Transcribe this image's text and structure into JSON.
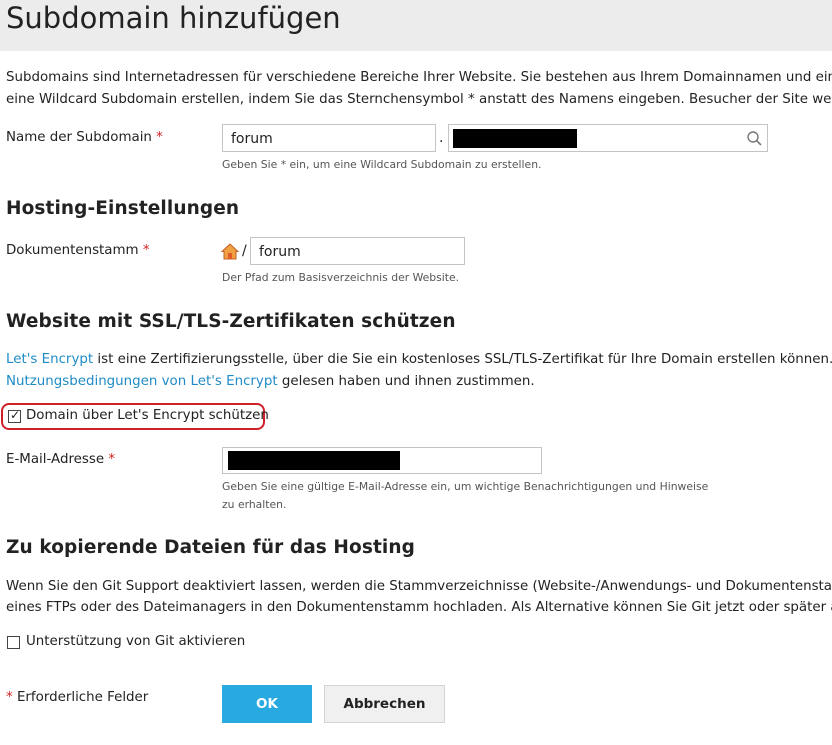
{
  "page": {
    "title": "Subdomain hinzufügen"
  },
  "intro": {
    "line1": "Subdomains sind Internetadressen für verschiedene Bereiche Ihrer Website. Sie bestehen aus Ihrem Domainnamen und einem",
    "line2": "eine Wildcard Subdomain erstellen, indem Sie das Sternchensymbol * anstatt des Namens eingeben. Besucher der Site werden"
  },
  "subdomain": {
    "label": "Name der Subdomain",
    "required_mark": "*",
    "value": "forum",
    "dot": ".",
    "hint": "Geben Sie * ein, um eine Wildcard Subdomain zu erstellen."
  },
  "hosting": {
    "heading": "Hosting-Einstellungen",
    "docroot_label": "Dokumentenstamm",
    "required_mark": "*",
    "slash": "/",
    "docroot_value": "forum",
    "hint": "Der Pfad zum Basisverzeichnis der Website."
  },
  "ssl": {
    "heading": "Website mit SSL/TLS-Zertifikaten schützen",
    "link1": "Let's Encrypt",
    "text1": " ist eine Zertifizierungsstelle, über die Sie ein kostenloses SSL/TLS-Zertifikat für Ihre Domain erstellen können. Das",
    "link2": "Nutzungsbedingungen von Let's Encrypt",
    "text2": " gelesen haben und ihnen zustimmen.",
    "checkbox_label": "Domain über Let's Encrypt schützen",
    "checkbox_checked": true,
    "email_label": "E-Mail-Adresse",
    "required_mark": "*",
    "email_hint_line1": "Geben Sie eine gültige E-Mail-Adresse ein, um wichtige Benachrichtigungen und Hinweise",
    "email_hint_line2": "zu erhalten."
  },
  "files": {
    "heading": "Zu kopierende Dateien für das Hosting",
    "line1": "Wenn Sie den Git Support deaktiviert lassen, werden die Stammverzeichnisse (Website-/Anwendungs- und Dokumentenstamm",
    "line2": "eines FTPs oder des Dateimanagers in den Dokumentenstamm hochladen. Als Alternative können Sie Git jetzt oder später aktiv",
    "git_label": "Unterstützung von Git aktivieren",
    "git_checked": false
  },
  "footer": {
    "required_mark": "*",
    "required_text": " Erforderliche Felder",
    "ok_label": "OK",
    "cancel_label": "Abbrechen"
  },
  "colors": {
    "accent": "#28a9e0",
    "link": "#1f8bc6",
    "required": "#d02020",
    "highlight": "#d0202a"
  }
}
